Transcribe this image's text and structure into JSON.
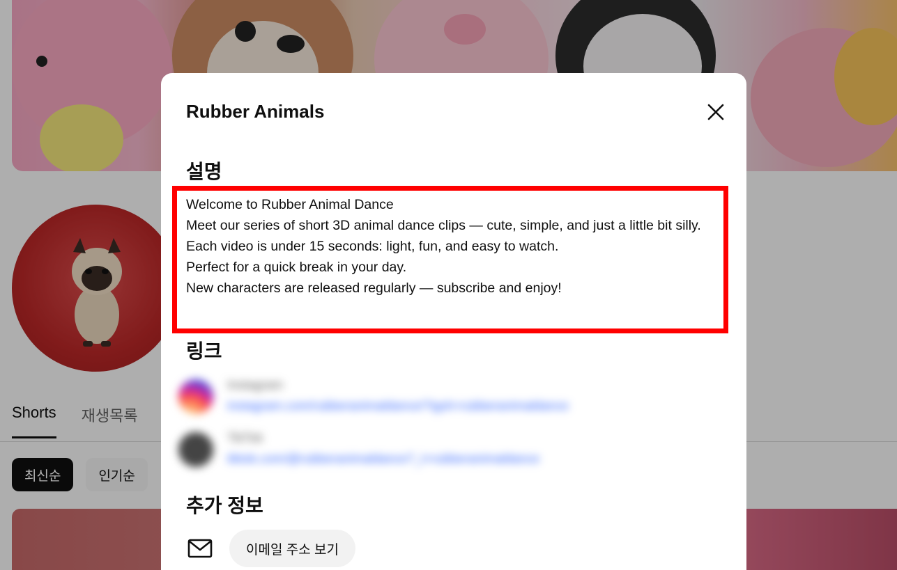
{
  "background": {
    "tabs": [
      {
        "label": "Shorts",
        "active": true
      },
      {
        "label": "재생목록",
        "active": false
      }
    ],
    "chips": [
      {
        "label": "최신순",
        "active": true
      },
      {
        "label": "인기순",
        "active": false
      }
    ]
  },
  "dialog": {
    "title": "Rubber Animals",
    "close_icon": "close-icon",
    "description_heading": "설명",
    "description_lines": [
      "Welcome to Rubber Animal Dance",
      "Meet our series of short 3D animal dance clips — cute, simple, and just a little bit silly.",
      "Each video is under 15 seconds: light, fun, and easy to watch.",
      "Perfect for a quick break in your day.",
      "New characters are released regularly — subscribe and enjoy!"
    ],
    "links_heading": "링크",
    "links": [
      {
        "name": "Instagram",
        "url": "instagram.com/rubberanimaldance/?igsh=rubberanimaldance",
        "icon": "instagram-icon"
      },
      {
        "name": "TikTok",
        "url": "tiktok.com/@rubberanimaldance?_t=rubberanimaldance",
        "icon": "tiktok-icon"
      }
    ],
    "more_info_heading": "추가 정보",
    "email_button_label": "이메일 주소 보기",
    "mail_icon": "mail-icon",
    "highlight_color": "#ff0000"
  }
}
